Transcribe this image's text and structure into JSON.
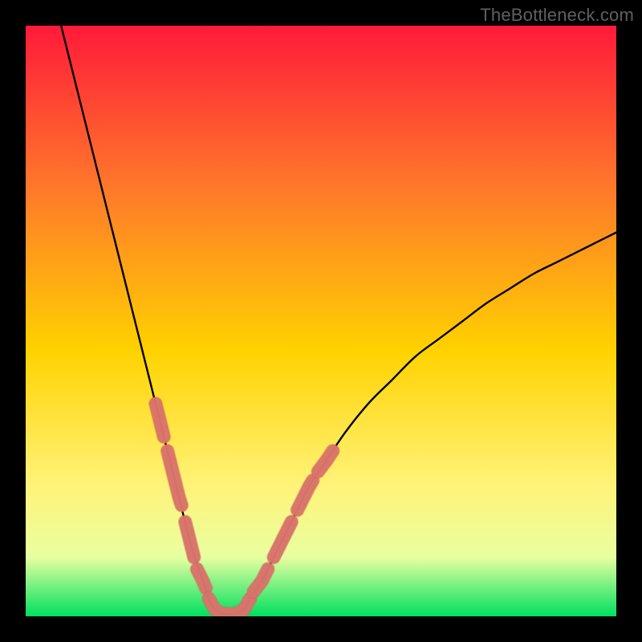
{
  "watermark": "TheBottleneck.com",
  "colors": {
    "bg": "#000000",
    "grad_top": "#ff1a3a",
    "grad_upper_mid": "#ff7a2a",
    "grad_mid": "#ffd200",
    "grad_lower_mid": "#fff37a",
    "grad_lower": "#e8ffa0",
    "grad_bottom": "#00e060",
    "curve": "#000000",
    "marker_fill": "#d9746b",
    "marker_stroke": "#c85a52"
  },
  "chart_data": {
    "type": "line",
    "title": "",
    "xlabel": "",
    "ylabel": "",
    "xlim": [
      0,
      100
    ],
    "ylim": [
      0,
      100
    ],
    "grid": false,
    "legend": false,
    "series": [
      {
        "name": "bottleneck-curve",
        "x": [
          6,
          8,
          10,
          12,
          14,
          16,
          18,
          20,
          22,
          24,
          26,
          28,
          30,
          31,
          32,
          33,
          34,
          35,
          36,
          37,
          38,
          40,
          42,
          44,
          46,
          48,
          50,
          54,
          58,
          62,
          66,
          70,
          74,
          78,
          82,
          86,
          90,
          94,
          98,
          100
        ],
        "y": [
          100,
          92,
          84,
          76,
          68,
          60,
          52,
          44,
          36,
          28,
          20,
          12,
          6,
          3,
          1.2,
          0.6,
          0.4,
          0.4,
          0.6,
          1.2,
          3,
          6,
          10,
          14,
          18,
          22,
          25,
          31,
          36,
          40,
          44,
          47,
          50,
          53,
          55.5,
          58,
          60,
          62,
          64,
          65
        ]
      }
    ],
    "markers": {
      "name": "highlighted-segments",
      "segments": [
        [
          [
            22,
            36
          ],
          [
            23,
            32
          ],
          [
            23.4,
            30.4
          ]
        ],
        [
          [
            24,
            28
          ],
          [
            26,
            20
          ],
          [
            26.4,
            18.8
          ]
        ],
        [
          [
            27,
            16
          ],
          [
            28,
            12
          ],
          [
            28.5,
            10
          ]
        ],
        [
          [
            29,
            8
          ],
          [
            30,
            6
          ],
          [
            30.5,
            4.8
          ]
        ],
        [
          [
            31,
            3
          ],
          [
            32,
            1.2
          ],
          [
            33,
            0.6
          ],
          [
            34,
            0.4
          ],
          [
            35,
            0.4
          ],
          [
            36,
            0.6
          ],
          [
            37,
            1.2
          ],
          [
            38,
            3
          ]
        ],
        [
          [
            38.6,
            4.2
          ],
          [
            40,
            6
          ],
          [
            41,
            8
          ]
        ],
        [
          [
            42,
            10
          ],
          [
            44,
            14
          ],
          [
            45,
            16
          ]
        ],
        [
          [
            46,
            18
          ],
          [
            48,
            22
          ],
          [
            48.6,
            23
          ]
        ],
        [
          [
            49.5,
            24.5
          ],
          [
            51,
            26.5
          ],
          [
            52,
            28
          ]
        ]
      ]
    }
  }
}
